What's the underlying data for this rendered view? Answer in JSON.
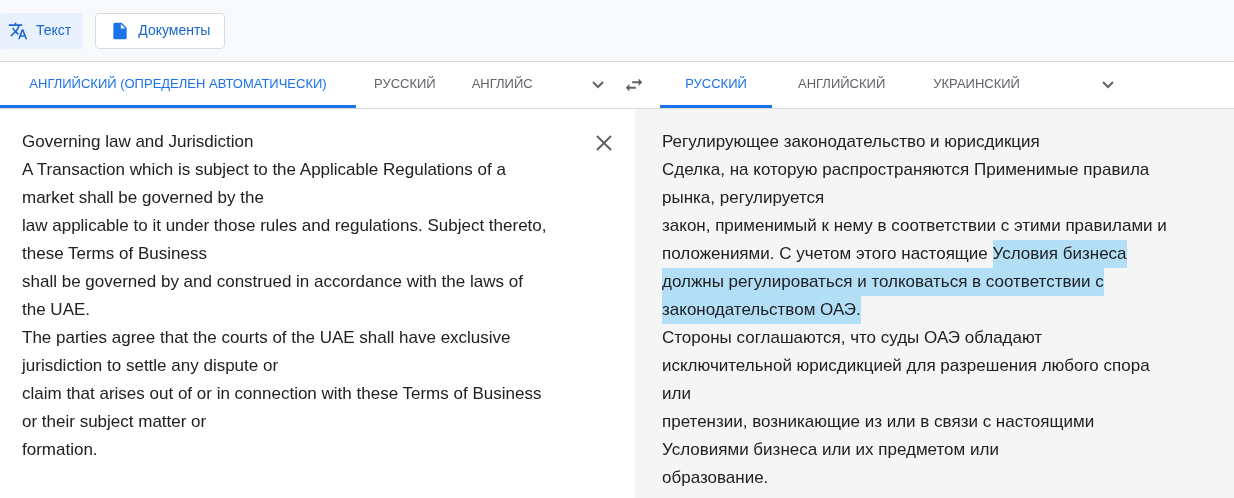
{
  "modes": [
    {
      "label": "Текст",
      "kind": "translate",
      "selected": true
    },
    {
      "label": "Документы",
      "kind": "document",
      "selected": false
    }
  ],
  "source_tabs": [
    {
      "label": "АНГЛИЙСКИЙ (ОПРЕДЕЛЕН АВТОМАТИЧЕСКИ)",
      "selected": true
    },
    {
      "label": "РУССКИЙ",
      "selected": false
    },
    {
      "label": "АНГЛИЙС",
      "selected": false
    }
  ],
  "target_tabs": [
    {
      "label": "РУССКИЙ",
      "selected": true
    },
    {
      "label": "АНГЛИЙСКИЙ",
      "selected": false
    },
    {
      "label": "УКРАИНСКИЙ",
      "selected": false
    }
  ],
  "source_text": [
    "Governing law and Jurisdiction",
    "A Transaction which is subject to the Applicable Regulations of a",
    "market shall be governed by the",
    "law applicable to it under those rules and regulations. Subject thereto,",
    "these Terms of Business",
    "shall be governed by and construed in accordance with the laws of",
    "the UAE.",
    "The parties agree that the courts of the UAE shall have exclusive",
    "jurisdiction to settle any dispute or",
    "claim that arises out of or in connection with these Terms of Business",
    "or their subject matter or",
    "formation."
  ],
  "translation": [
    [
      {
        "text": "Регулирующее законодательство и юрисдикция",
        "highlighted": false
      }
    ],
    [
      {
        "text": "Сделка, на которую распространяются Применимые правила",
        "highlighted": false
      }
    ],
    [
      {
        "text": "рынка, регулируется",
        "highlighted": false
      }
    ],
    [
      {
        "text": "закон, применимый к нему в соответствии с этими правилами и",
        "highlighted": false
      }
    ],
    [
      {
        "text": "положениями. С учетом этого настоящие ",
        "highlighted": false
      },
      {
        "text": "Условия бизнеса",
        "highlighted": true
      }
    ],
    [
      {
        "text": "должны регулироваться и толковаться в соответствии с",
        "highlighted": true
      }
    ],
    [
      {
        "text": "законодательством ОАЭ.",
        "highlighted": true
      }
    ],
    [
      {
        "text": "Стороны соглашаются, что суды ОАЭ обладают",
        "highlighted": false
      }
    ],
    [
      {
        "text": "исключительной юрисдикцией для разрешения любого спора",
        "highlighted": false
      }
    ],
    [
      {
        "text": "или",
        "highlighted": false
      }
    ],
    [
      {
        "text": "претензии, возникающие из или в связи с настоящими",
        "highlighted": false
      }
    ],
    [
      {
        "text": "Условиями бизнеса или их предметом или",
        "highlighted": false
      }
    ],
    [
      {
        "text": "образование.",
        "highlighted": false
      }
    ]
  ]
}
